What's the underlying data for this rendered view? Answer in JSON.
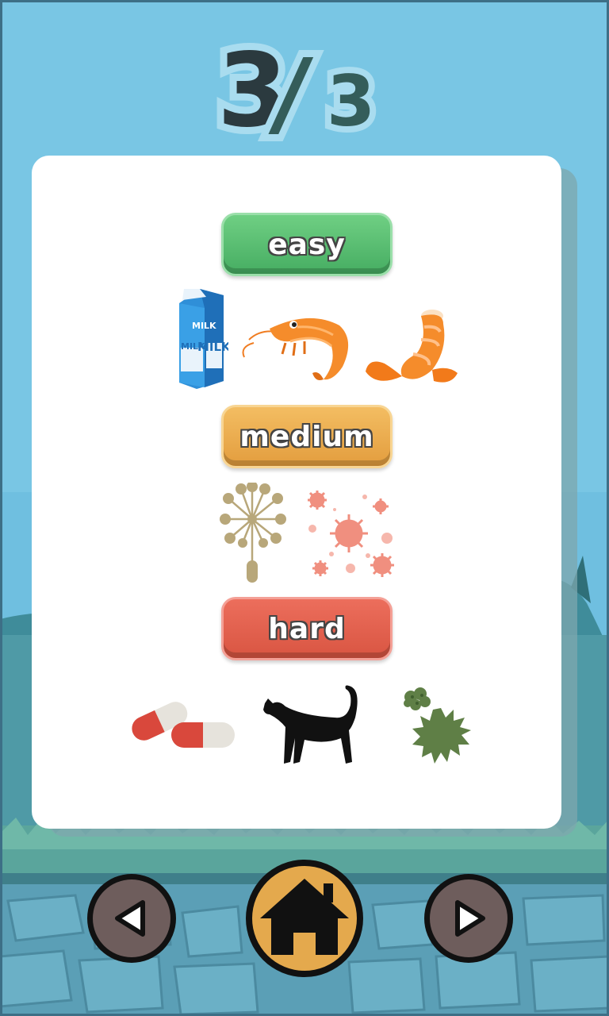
{
  "progress": {
    "current": "3",
    "separator": "/",
    "total": "3"
  },
  "levels": [
    {
      "label": "easy",
      "items": [
        "milk-carton-icon",
        "shrimp-icon",
        "shelled-shrimp-icon"
      ]
    },
    {
      "label": "medium",
      "items": [
        "dandelion-pollen-icon",
        "germs-icon"
      ]
    },
    {
      "label": "hard",
      "items": [
        "pills-icon",
        "cat-icon",
        "mold-icon"
      ]
    }
  ],
  "milk_label": "MILK",
  "nav": {
    "prev": "previous-button",
    "home": "home-button",
    "next": "next-button"
  },
  "colors": {
    "easy": "#4fb46b",
    "medium": "#e8a64a",
    "hard": "#df5b48",
    "nav": "#6e5d5c",
    "home": "#e4a94d"
  }
}
